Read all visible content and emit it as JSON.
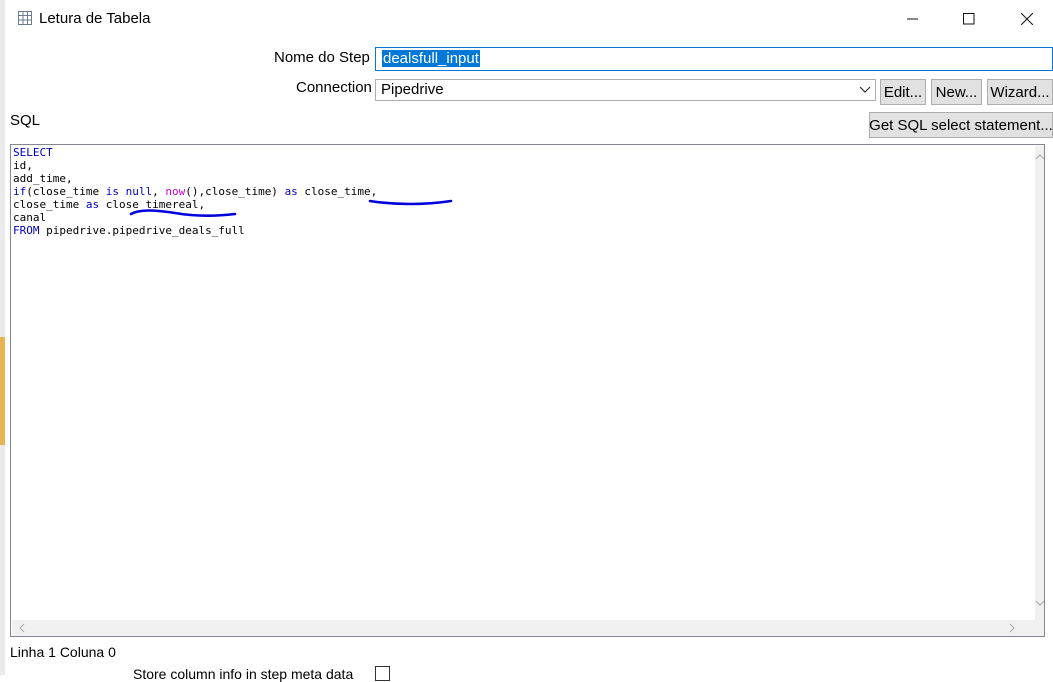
{
  "window": {
    "title": "Letura de Tabela",
    "icon": "table-grid-icon"
  },
  "form": {
    "step_name_label": "Nome do Step",
    "step_name_value": "dealsfull_input",
    "connection_label": "Connection",
    "connection_value": "Pipedrive",
    "edit_label": "Edit...",
    "new_label": "New...",
    "wizard_label": "Wizard...",
    "sql_label": "SQL",
    "get_sql_label": "Get SQL select statement..."
  },
  "sql": {
    "lines": [
      [
        {
          "t": "SELECT",
          "c": "kw"
        }
      ],
      [
        {
          "t": "id,",
          "c": ""
        }
      ],
      [
        {
          "t": "add_time,",
          "c": ""
        }
      ],
      [
        {
          "t": "if",
          "c": "kw"
        },
        {
          "t": "(close_time ",
          "c": ""
        },
        {
          "t": "is null",
          "c": "kw"
        },
        {
          "t": ", ",
          "c": ""
        },
        {
          "t": "now",
          "c": "fn"
        },
        {
          "t": "(),close_time) ",
          "c": ""
        },
        {
          "t": "as",
          "c": "kw"
        },
        {
          "t": " close_time,",
          "c": ""
        }
      ],
      [
        {
          "t": "close_time ",
          "c": ""
        },
        {
          "t": "as",
          "c": "kw"
        },
        {
          "t": " close_timereal,",
          "c": ""
        }
      ],
      [
        {
          "t": "canal",
          "c": ""
        }
      ],
      [
        {
          "t": "FROM",
          "c": "kw"
        },
        {
          "t": " pipedrive.pipedrive_deals_full",
          "c": ""
        }
      ]
    ]
  },
  "status": {
    "position_text": "Linha 1 Coluna 0"
  },
  "store_column_label": "Store column info in step meta data",
  "colors": {
    "keyword": "#0000c0",
    "function": "#cc00cc",
    "selection": "#0078d7",
    "annotation": "#0000dd"
  }
}
